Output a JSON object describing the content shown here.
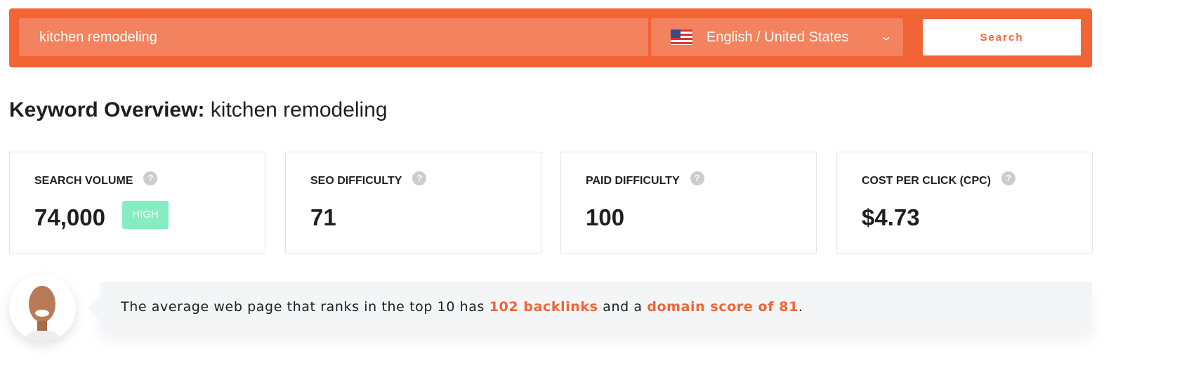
{
  "search": {
    "query": "kitchen remodeling",
    "language": "English / United States",
    "button": "Search"
  },
  "title": {
    "bold": "Keyword Overview:",
    "keyword": "kitchen remodeling"
  },
  "cards": [
    {
      "label": "SEARCH VOLUME",
      "value": "74,000",
      "badge": "HIGH"
    },
    {
      "label": "SEO DIFFICULTY",
      "value": "71"
    },
    {
      "label": "PAID DIFFICULTY",
      "value": "100"
    },
    {
      "label": "COST PER CLICK (CPC)",
      "value": "$4.73"
    }
  ],
  "help_icon": "?",
  "callout": {
    "pre": "The average web page that ranks in the top 10 has ",
    "backlinks": "102 backlinks",
    "mid": " and a ",
    "domain": "domain score of 81",
    "post": "."
  },
  "colors": {
    "brand": "#f26435",
    "badge_high": "#86ecc2"
  }
}
